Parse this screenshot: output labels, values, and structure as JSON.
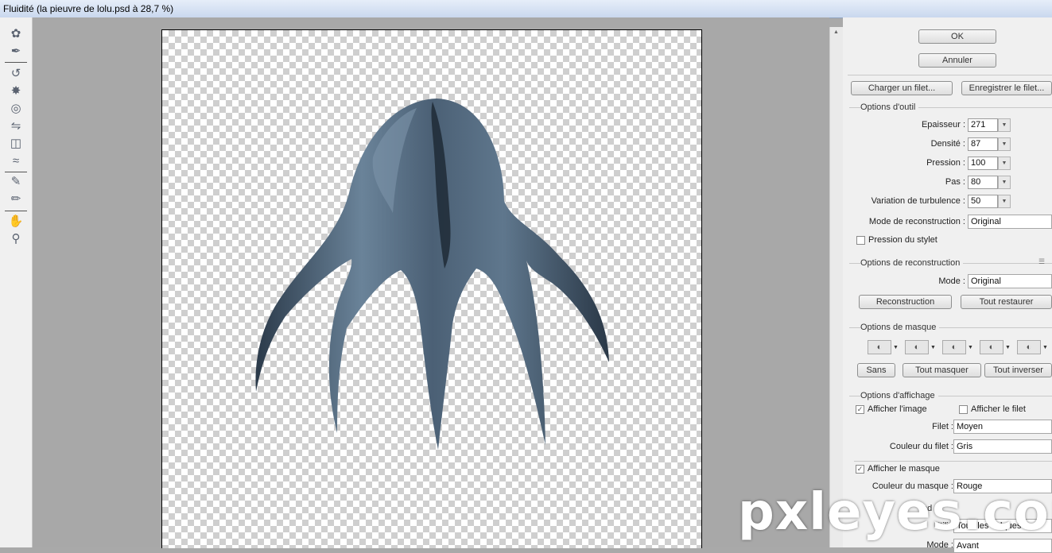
{
  "window": {
    "title": "Fluidité (la pieuvre  de lolu.psd à 28,7 %)"
  },
  "tools": [
    {
      "icon": "warp-tool-icon"
    },
    {
      "icon": "reconstruct-tool-icon"
    },
    {
      "icon": "twirl-tool-icon"
    },
    {
      "icon": "pucker-tool-icon"
    },
    {
      "icon": "bloat-tool-icon"
    },
    {
      "icon": "push-left-tool-icon"
    },
    {
      "icon": "mirror-tool-icon"
    },
    {
      "icon": "turbulence-tool-icon"
    },
    {
      "icon": "freeze-mask-tool-icon"
    },
    {
      "icon": "thaw-mask-tool-icon"
    },
    {
      "icon": "hand-tool-icon"
    },
    {
      "icon": "zoom-tool-icon"
    }
  ],
  "buttons": {
    "ok": "OK",
    "cancel": "Annuler",
    "load_mesh": "Charger un filet...",
    "save_mesh": "Enregistrer le filet..."
  },
  "tool_options": {
    "title": "Options d'outil",
    "brush_size_label": "Epaisseur :",
    "brush_size": "271",
    "density_label": "Densité :",
    "density": "87",
    "pressure_label": "Pression :",
    "pressure": "100",
    "rate_label": "Pas :",
    "rate": "80",
    "turbulent_jitter_label": "Variation de turbulence :",
    "turbulent_jitter": "50",
    "reconstruct_mode_label": "Mode de reconstruction :",
    "reconstruct_mode": "Original",
    "stylus_pressure_label": "Pression du stylet"
  },
  "reconstruct_options": {
    "title": "Options de reconstruction",
    "mode_label": "Mode :",
    "mode": "Original",
    "reconstruct_button": "Reconstruction",
    "restore_all_button": "Tout restaurer"
  },
  "mask_options": {
    "title": "Options de masque",
    "none_button": "Sans",
    "mask_all_button": "Tout masquer",
    "invert_all_button": "Tout inverser"
  },
  "view_options": {
    "title": "Options d'affichage",
    "show_image_label": "Afficher l'image",
    "show_image_checked": true,
    "show_mesh_label": "Afficher le filet",
    "show_mesh_checked": false,
    "mesh_size_label": "Filet :",
    "mesh_size": "Moyen",
    "mesh_color_label": "Couleur du filet :",
    "mesh_color": "Gris",
    "show_mask_label": "Afficher le masque",
    "show_mask_checked": true,
    "mask_color_label": "Couleur du masque :",
    "mask_color": "Rouge",
    "backdrop_title_partial": "nd",
    "use_label": "Utiliser :",
    "use_value": "Tous les calques",
    "mode_label": "Mode :",
    "mode_value": "Avant"
  },
  "watermark": "pxleyes.com",
  "colors": {
    "creature": "#5a7186",
    "creature_dark": "#1e2a36",
    "panel_bg": "#f0f0f0",
    "workspace_bg": "#a8a8a8"
  }
}
